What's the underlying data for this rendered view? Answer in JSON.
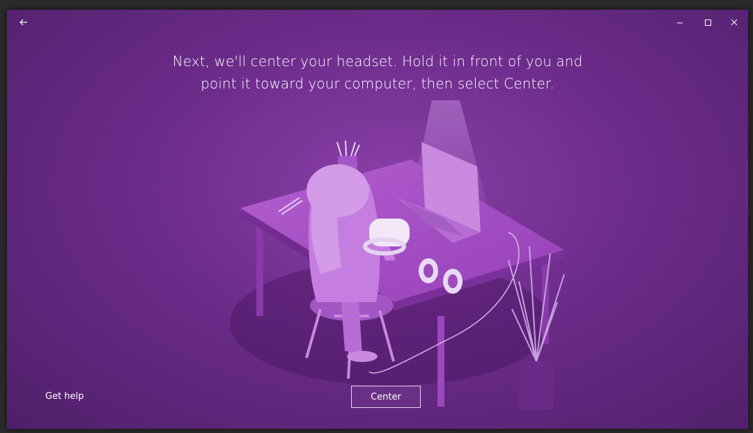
{
  "titlebar": {
    "back_icon": "back-arrow-icon",
    "minimize_icon": "minimize-icon",
    "maximize_icon": "maximize-icon",
    "close_icon": "close-icon"
  },
  "main": {
    "instruction_line1": "Next, we'll center your headset. Hold it in front of you and",
    "instruction_line2": "point it toward your computer, then select Center."
  },
  "footer": {
    "help_link": "Get help",
    "center_button": "Center"
  },
  "colors": {
    "background": "#6c2c8a",
    "text": "#ffffff"
  }
}
